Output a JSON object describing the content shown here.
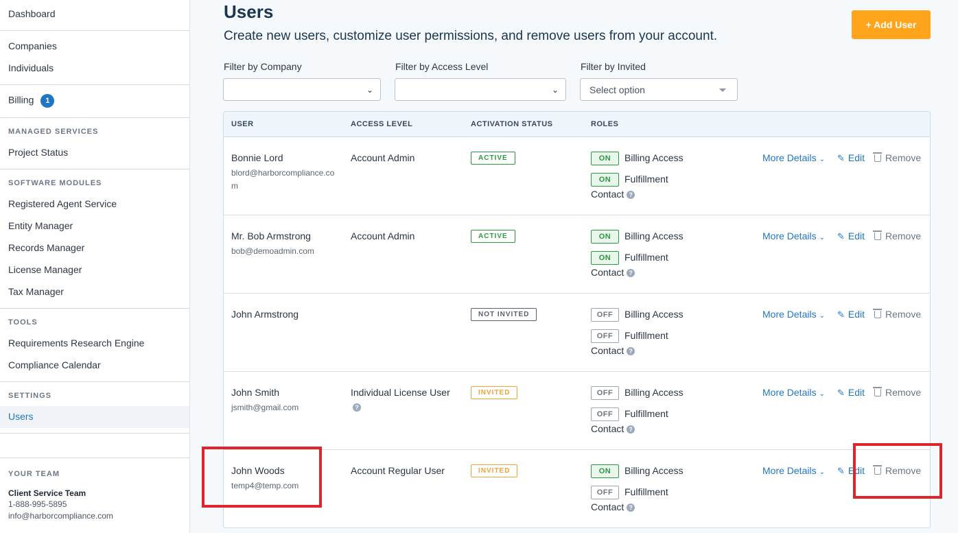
{
  "sidebar": {
    "dashboard": "Dashboard",
    "companies": "Companies",
    "individuals": "Individuals",
    "billing": "Billing",
    "billing_badge": "1",
    "managed_services_heading": "MANAGED SERVICES",
    "project_status": "Project Status",
    "software_modules_heading": "SOFTWARE MODULES",
    "registered_agent": "Registered Agent Service",
    "entity_manager": "Entity Manager",
    "records_manager": "Records Manager",
    "license_manager": "License Manager",
    "tax_manager": "Tax Manager",
    "tools_heading": "TOOLS",
    "requirements_engine": "Requirements Research Engine",
    "compliance_calendar": "Compliance Calendar",
    "settings_heading": "SETTINGS",
    "users": "Users",
    "your_team_heading": "YOUR TEAM",
    "team_name": "Client Service Team",
    "team_phone": "1-888-995-5895",
    "team_email": "info@harborcompliance.com"
  },
  "page": {
    "title": "Users",
    "subtitle": "Create new users, customize user permissions, and remove users from your account.",
    "add_user_label": "+ Add User"
  },
  "filters": {
    "company_label": "Filter by Company",
    "company_value": "",
    "access_label": "Filter by Access Level",
    "access_value": "",
    "invited_label": "Filter by Invited",
    "invited_placeholder": "Select option"
  },
  "table": {
    "headers": [
      "USER",
      "ACCESS LEVEL",
      "ACTIVATION STATUS",
      "ROLES"
    ],
    "role_billing": "Billing Access",
    "role_fulfillment_1": "Fulfillment",
    "role_fulfillment_2": "Contact",
    "more_details": "More Details",
    "edit": "Edit",
    "remove": "Remove",
    "rows": [
      {
        "name": "Bonnie Lord",
        "email": "blord@harborcompliance.com",
        "access": "Account Admin",
        "status": "ACTIVE",
        "billing": "ON",
        "fulfillment": "ON"
      },
      {
        "name": "Mr. Bob Armstrong",
        "email": "bob@demoadmin.com",
        "access": "Account Admin",
        "status": "ACTIVE",
        "billing": "ON",
        "fulfillment": "ON"
      },
      {
        "name": "John Armstrong",
        "email": "",
        "access": "",
        "status": "NOT INVITED",
        "billing": "OFF",
        "fulfillment": "OFF"
      },
      {
        "name": "John Smith",
        "email": "jsmith@gmail.com",
        "access": "Individual License User",
        "status": "INVITED",
        "billing": "OFF",
        "fulfillment": "OFF"
      },
      {
        "name": "John Woods",
        "email": "temp4@temp.com",
        "access": "Account Regular User",
        "status": "INVITED",
        "billing": "ON",
        "fulfillment": "OFF"
      }
    ]
  },
  "colors": {
    "accent": "#1f76c2",
    "add_button": "#ffa41b",
    "active": "#2a9a3f",
    "invited": "#f0a23a",
    "highlight": "#e0242b"
  }
}
